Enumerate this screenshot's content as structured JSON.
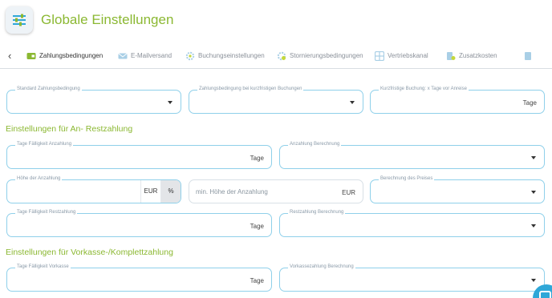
{
  "header": {
    "title": "Globale Einstellungen"
  },
  "tabs": [
    {
      "label": "Zahlungsbedingungen",
      "icon": "payment-card-icon",
      "active": true
    },
    {
      "label": "E-Mailversand",
      "icon": "mail-icon",
      "active": false
    },
    {
      "label": "Buchungseinstellungen",
      "icon": "gear-icon",
      "active": false
    },
    {
      "label": "Stornierungsbedingungen",
      "icon": "cancel-gear-icon",
      "active": false
    },
    {
      "label": "Vertriebskanal",
      "icon": "grid-icon",
      "active": false
    },
    {
      "label": "Zusatzkosten",
      "icon": "cost-list-icon",
      "active": false
    }
  ],
  "general": {
    "standard": {
      "label": "Standard Zahlungsbedingung"
    },
    "short_term": {
      "label": "Zahlungsbedingung bei kurzfristigen Buchungen"
    },
    "short_days": {
      "label": "Kurzfristige Buchung: x Tage vor Anreise",
      "suffix": "Tage"
    }
  },
  "deposit": {
    "title": "Einstellungen für An- Restzahlung",
    "due_days": {
      "label": "Tage Fälligkeit Anzahlung",
      "suffix": "Tage"
    },
    "calc": {
      "label": "Anzahlung Berechnung"
    },
    "amount": {
      "label": "Höhe der Anzahlung",
      "unit_eur": "EUR",
      "unit_pct": "%"
    },
    "min_amount": {
      "placeholder": "min. Höhe der Anzahlung",
      "suffix": "EUR"
    },
    "price_calc": {
      "label": "Berechnung des Preises"
    },
    "rest_days": {
      "label": "Tage Fälligkeit Restzahlung",
      "suffix": "Tage"
    },
    "rest_calc": {
      "label": "Restzahlung Berechnung"
    }
  },
  "prepay": {
    "title": "Einstellungen für Vorkasse-/Komplettzahlung",
    "due_days": {
      "label": "Tage Fälligkeit Vorkasse",
      "suffix": "Tage"
    },
    "calc": {
      "label": "Vorkassezahlung Berechnung"
    }
  },
  "colors": {
    "accent": "#8bb832",
    "field_border": "#8fd0ea",
    "chat": "#2ea7d8"
  }
}
